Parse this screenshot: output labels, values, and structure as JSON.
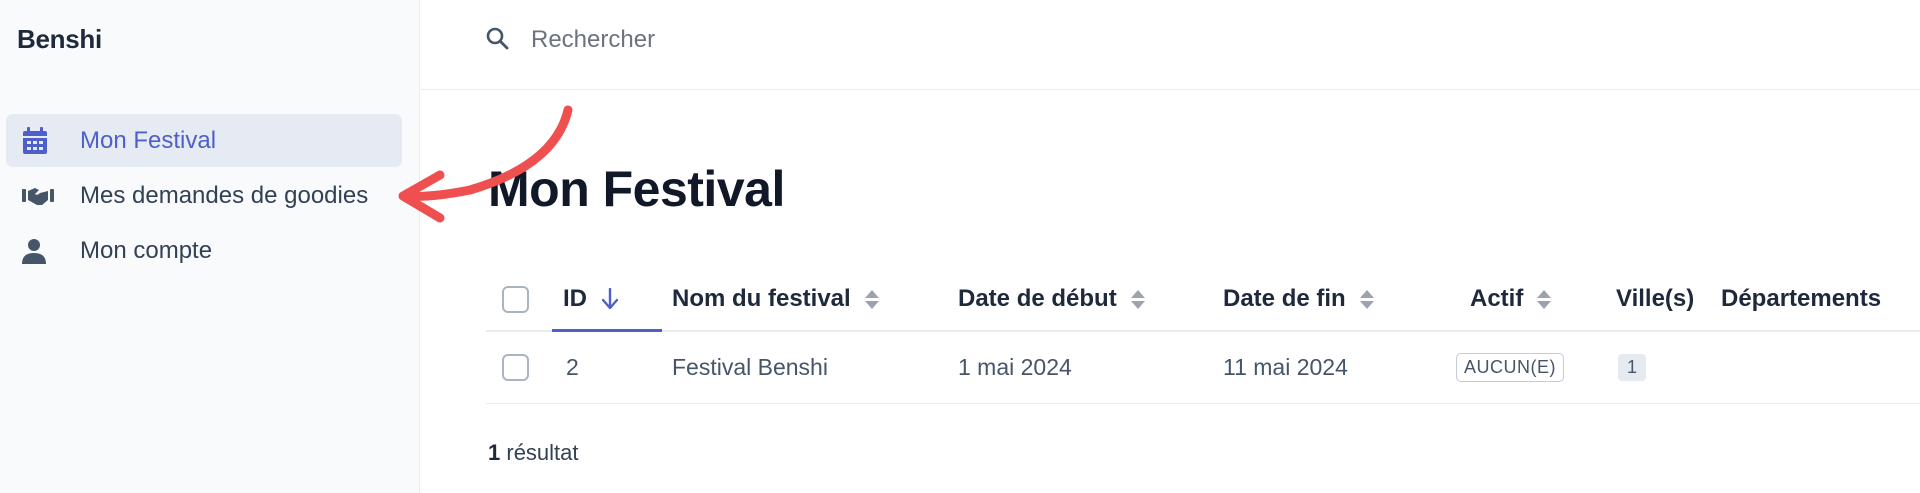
{
  "app": {
    "title": "Benshi"
  },
  "sidebar": {
    "items": [
      {
        "label": "Mon Festival",
        "icon": "calendar-icon",
        "active": true
      },
      {
        "label": "Mes demandes de goodies",
        "icon": "handshake-icon",
        "active": false
      },
      {
        "label": "Mon compte",
        "icon": "user-icon",
        "active": false
      }
    ]
  },
  "search": {
    "placeholder": "Rechercher",
    "icon": "search-icon"
  },
  "page": {
    "title": "Mon Festival"
  },
  "table": {
    "columns": {
      "id": "ID",
      "name": "Nom du festival",
      "start": "Date de début",
      "end": "Date de fin",
      "active": "Actif",
      "cities": "Ville(s)",
      "departments": "Départements"
    },
    "sort": {
      "column": "ID",
      "direction": "descending"
    },
    "rows": [
      {
        "id": "2",
        "name": "Festival Benshi",
        "start": "1 mai 2024",
        "end": "11 mai 2024",
        "active": "AUCUN(E)",
        "cities": "1"
      }
    ]
  },
  "result": {
    "count": "1",
    "label": "résultat"
  },
  "colors": {
    "accent": "#4f5fc9",
    "annotation_arrow": "#ef4f4f",
    "sidebar_bg": "#f8fafc",
    "active_bg": "#e6ebf3"
  }
}
